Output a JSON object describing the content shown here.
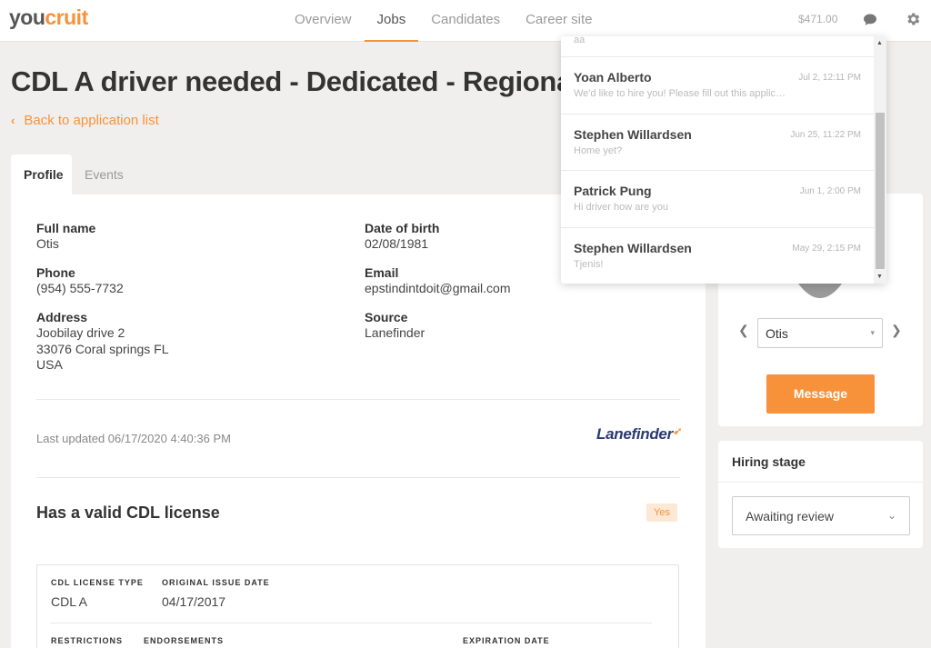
{
  "app": {
    "logo_main": "you",
    "logo_accent": "cruit"
  },
  "nav": {
    "items": [
      {
        "label": "Overview"
      },
      {
        "label": "Jobs",
        "active": true
      },
      {
        "label": "Candidates"
      },
      {
        "label": "Career site"
      }
    ],
    "balance": "$471.00",
    "icons": {
      "chat": "chat-bubble-icon",
      "settings": "gear-icon"
    }
  },
  "page": {
    "title": "CDL A driver needed - Dedicated - Regional - Tan",
    "back_label": "Back to application list"
  },
  "tabs": {
    "profile": "Profile",
    "events": "Events"
  },
  "profile": {
    "full_name_label": "Full name",
    "full_name": "Otis",
    "dob_label": "Date of birth",
    "dob": "02/08/1981",
    "phone_label": "Phone",
    "phone": "(954) 555-7732",
    "email_label": "Email",
    "email": "epstindintdoit@gmail.com",
    "address_label": "Address",
    "address_line1": "Joobilay drive 2",
    "address_line2": "33076 Coral springs FL",
    "address_line3": "USA",
    "source_label": "Source",
    "source": "Lanefinder",
    "last_updated": "Last updated 06/17/2020 4:40:36 PM",
    "source_logo_text": "Lanefinder"
  },
  "cdl": {
    "section_title": "Has a valid CDL license",
    "answer": "Yes",
    "license_type_label": "CDL LICENSE TYPE",
    "license_type": "CDL A",
    "issue_date_label": "ORIGINAL ISSUE DATE",
    "issue_date": "04/17/2017",
    "restrictions_label": "RESTRICTIONS",
    "endorsements_label": "ENDORSEMENTS",
    "expiration_label": "EXPIRATION DATE"
  },
  "candidate": {
    "selected": "Otis",
    "message_button": "Message"
  },
  "hiring": {
    "title": "Hiring stage",
    "stage": "Awaiting review"
  },
  "messages": {
    "top_fragment": "aa",
    "items": [
      {
        "name": "Yoan Alberto",
        "time": "Jul 2, 12:11 PM",
        "preview": "We'd like to hire you! Please fill out this application"
      },
      {
        "name": "Stephen Willardsen",
        "time": "Jun 25, 11:22 PM",
        "preview": "Home yet?"
      },
      {
        "name": "Patrick Pung",
        "time": "Jun 1, 2:00 PM",
        "preview": "Hi driver how are you"
      },
      {
        "name": "Stephen Willardsen",
        "time": "May 29, 2:15 PM",
        "preview": "Tjenis!"
      }
    ]
  },
  "colors": {
    "accent": "#f7923a",
    "background": "#f1efed",
    "brand_navy": "#2a3b70"
  }
}
